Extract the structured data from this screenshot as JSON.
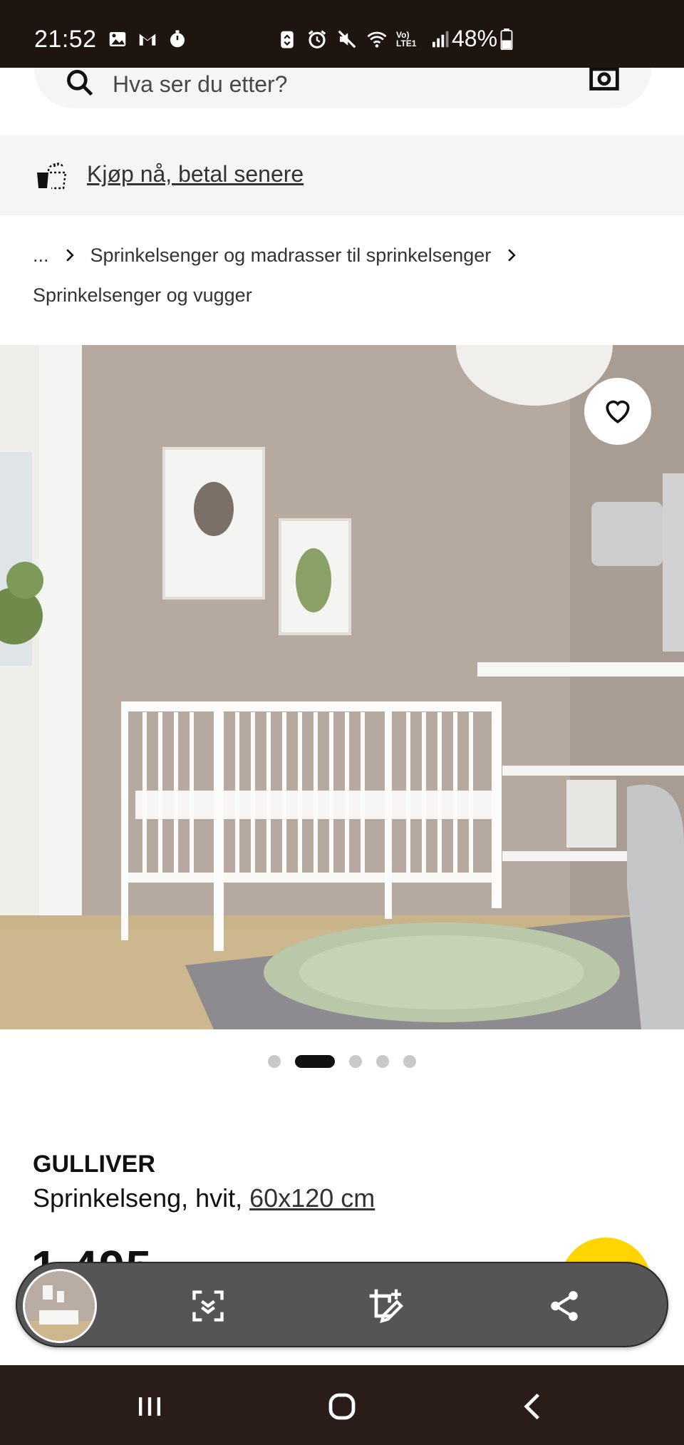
{
  "status_bar": {
    "time": "21:52",
    "battery": "48%",
    "left_icons": [
      "gallery-icon",
      "gmail-icon",
      "timer-icon"
    ],
    "right_icons": [
      "recycle-icon",
      "alarm-icon",
      "mute-icon",
      "wifi-icon",
      "volte-icon",
      "signal-icon",
      "battery-icon"
    ],
    "volte_label": "Vo) LTE1"
  },
  "search": {
    "placeholder": "Hva ser du etter?"
  },
  "bnpl": {
    "link_text": "Kjøp nå, betal senere"
  },
  "breadcrumb": {
    "ellipsis": "...",
    "items": [
      "Sprinkelsenger og madrasser til sprinkelsenger",
      "Sprinkelsenger og vugger"
    ]
  },
  "carousel": {
    "total": 5,
    "active_index": 1
  },
  "product": {
    "name": "GULLIVER",
    "desc_prefix": "Sprinkelseng, hvit, ",
    "size_link": "60x120 cm",
    "price_partial": "1 495"
  },
  "colors": {
    "status_bar_bg": "#1e1510",
    "nav_bar_bg": "#2a1c19",
    "cart_button": "#ffd500",
    "toolbar_bg": "#555555"
  }
}
